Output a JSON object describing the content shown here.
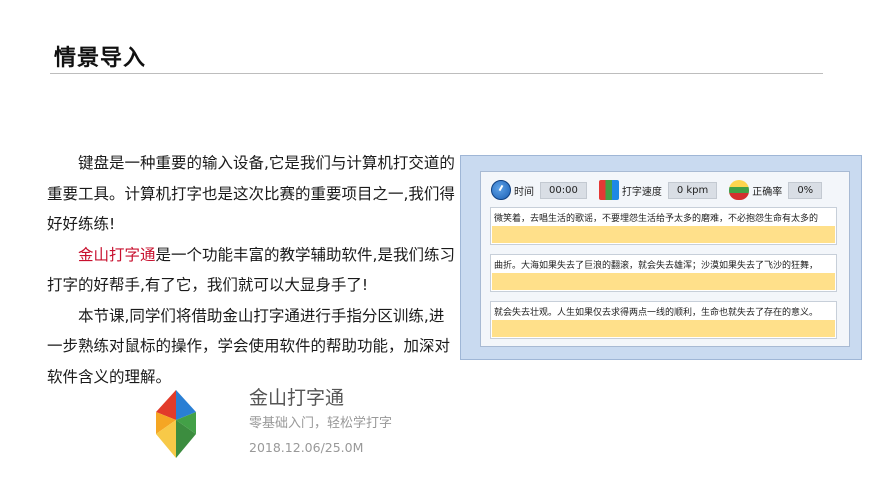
{
  "slide": {
    "title": "情景导入"
  },
  "body": {
    "p1": "键盘是一种重要的输入设备,它是我们与计算机打交道的重要工具。计算机打字也是这次比赛的重要项目之一,我们得好好练练!",
    "p2_highlight": "金山打字通",
    "p2_rest": "是一个功能丰富的教学辅助软件,是我们练习打字的好帮手,有了它，我们就可以大显身手了!",
    "p3": "本节课,同学们将借助金山打字通进行手指分区训练,进一步熟练对鼠标的操作，学会使用软件的帮助功能，加深对软件含义的理解。",
    "highlight_color": "#c8102e"
  },
  "typing_app": {
    "stats": [
      {
        "icon": "clock-icon",
        "label": "时间",
        "value": "00:00"
      },
      {
        "icon": "speed-icon",
        "label": "打字速度",
        "value": "0 kpm"
      },
      {
        "icon": "accuracy-icon",
        "label": "正确率",
        "value": "0%"
      }
    ],
    "lines": [
      "微笑着，去唱生活的歌谣，不要埋怨生活给予太多的磨难，不必抱怨生命有太多的",
      "曲折。大海如果失去了巨浪的翻滚，就会失去雄浑；沙漠如果失去了飞沙的狂舞，",
      "就会失去壮观。人生如果仅去求得两点一线的顺利，生命也就失去了存在的意义。"
    ],
    "typed_color": "#ffe08a"
  },
  "product": {
    "name": "金山打字通",
    "tagline": "零基础入门，轻松学打字",
    "meta": "2018.12.06/25.0M"
  }
}
